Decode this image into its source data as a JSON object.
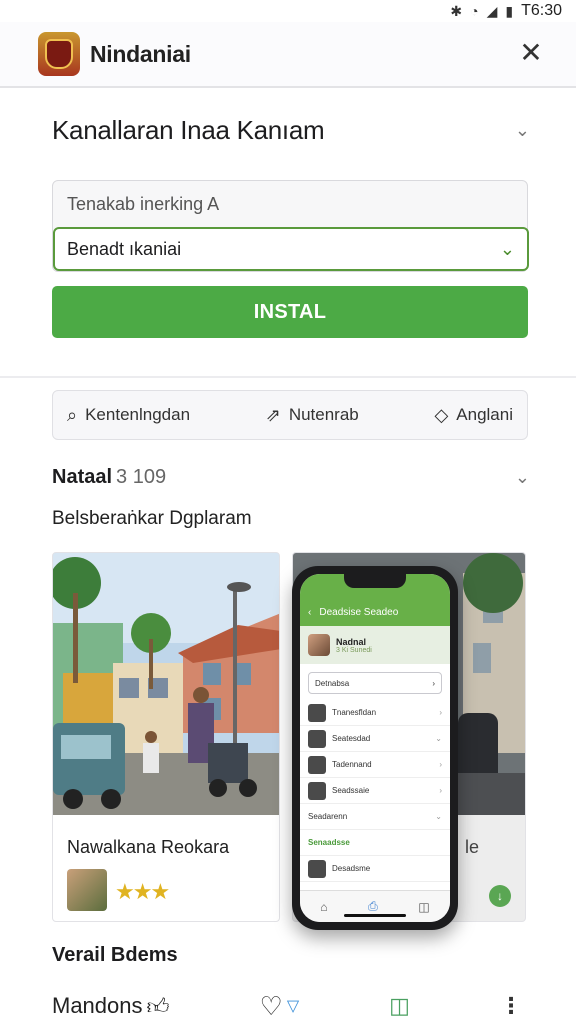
{
  "status_bar": {
    "bluetooth_icon": "bluetooth-icon",
    "wifi_icon": "wifi-icon",
    "signal_icon": "signal-icon",
    "battery_icon": "battery-icon",
    "time": "T6:30"
  },
  "app_bar": {
    "title": "Nindaniai",
    "close_icon": "close-icon"
  },
  "form": {
    "section_title": "Kanallaran Inaa Kanıam",
    "field_placeholder": "Tenakab inerking A",
    "selected_value": "Benadt ıkaniai",
    "install_label": "INSTAL"
  },
  "actions": [
    {
      "label": "Kentenlngdan",
      "icon": "search-icon"
    },
    {
      "label": "Nutenrab",
      "icon": "share-icon"
    },
    {
      "label": "Anglani",
      "icon": "chat-icon"
    }
  ],
  "news": {
    "title": "Nataal",
    "count": "3 109",
    "subheading": "Belsberaṅkar Dgplaram"
  },
  "cards": [
    {
      "caption": "Nawalkana Reokara",
      "rating_stars": 3
    },
    {
      "caption": "le"
    }
  ],
  "phone": {
    "header_title": "Deadsise Seadeo",
    "profile_name": "Nadnal",
    "profile_sub": "3 Ki Sunedi",
    "search_text": "Detnabsa",
    "rows": [
      {
        "text": "Tnanesfldan",
        "style": "normal"
      },
      {
        "text": "Seatesdad",
        "style": "normal"
      },
      {
        "text": "Tadennand",
        "style": "normal"
      },
      {
        "text": "Seadssaie",
        "style": "normal"
      },
      {
        "text": "Seadarenn",
        "style": "normal"
      },
      {
        "text": "Senaadsse",
        "style": "green"
      },
      {
        "text": "Desadsme",
        "style": "normal"
      }
    ]
  },
  "bottom": {
    "title": "Verail Bdems",
    "items": [
      {
        "label": "Mandons",
        "icon": "thumbs-up-icon"
      },
      {
        "label": "",
        "icon": "heart-icon"
      },
      {
        "label": "",
        "icon": "chat-bubble-icon"
      },
      {
        "label": "",
        "icon": "more-icon"
      }
    ]
  },
  "colors": {
    "primary_green": "#4caa45",
    "select_border": "#5a9a3c",
    "phone_header": "#68b048"
  }
}
